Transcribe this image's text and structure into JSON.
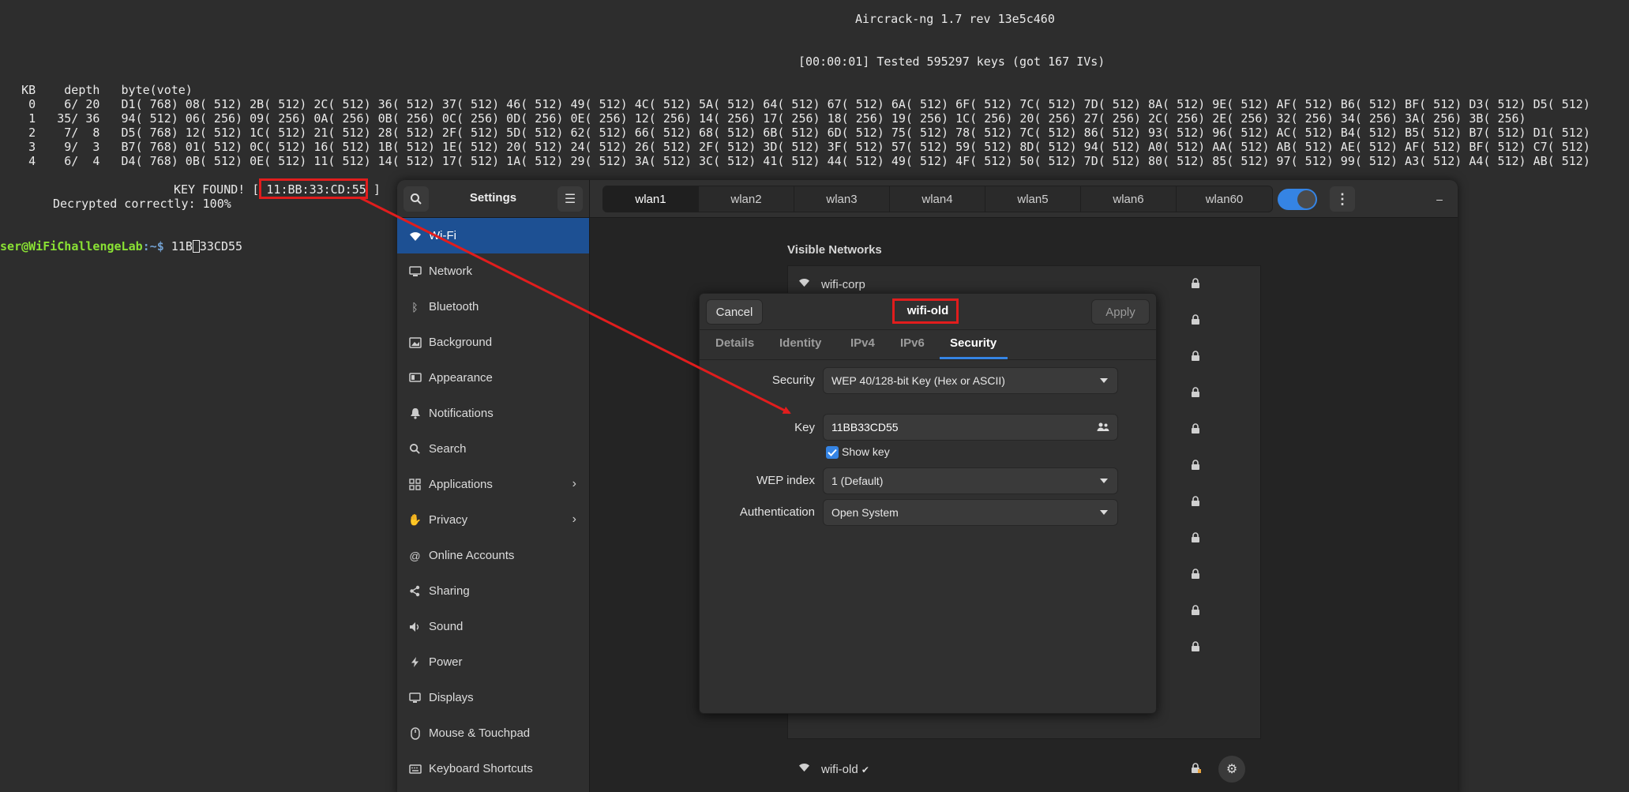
{
  "terminal": {
    "header": "Aircrack-ng 1.7 rev 13e5c460",
    "tested": "[00:00:01] Tested 595297 keys (got 167 IVs)",
    "table_header": "   KB    depth   byte(vote)",
    "rows": [
      "    0    6/ 20   D1( 768) 08( 512) 2B( 512) 2C( 512) 36( 512) 37( 512) 46( 512) 49( 512) 4C( 512) 5A( 512) 64( 512) 67( 512) 6A( 512) 6F( 512) 7C( 512) 7D( 512) 8A( 512) 9E( 512) AF( 512) B6( 512) BF( 512) D3( 512) D5( 512)",
      "    1   35/ 36   94( 512) 06( 256) 09( 256) 0A( 256) 0B( 256) 0C( 256) 0D( 256) 0E( 256) 12( 256) 14( 256) 17( 256) 18( 256) 19( 256) 1C( 256) 20( 256) 27( 256) 2C( 256) 2E( 256) 32( 256) 34( 256) 3A( 256) 3B( 256)",
      "    2    7/  8   D5( 768) 12( 512) 1C( 512) 21( 512) 28( 512) 2F( 512) 5D( 512) 62( 512) 66( 512) 68( 512) 6B( 512) 6D( 512) 75( 512) 78( 512) 7C( 512) 86( 512) 93( 512) 96( 512) AC( 512) B4( 512) B5( 512) B7( 512) D1( 512)",
      "    3    9/  3   B7( 768) 01( 512) 0C( 512) 16( 512) 1B( 512) 1E( 512) 20( 512) 24( 512) 26( 512) 2F( 512) 3D( 512) 3F( 512) 57( 512) 59( 512) 8D( 512) 94( 512) A0( 512) AA( 512) AB( 512) AE( 512) AF( 512) BF( 512) C7( 512)",
      "    4    6/  4   D4( 768) 0B( 512) 0E( 512) 11( 512) 14( 512) 17( 512) 1A( 512) 29( 512) 3A( 512) 3C( 512) 41( 512) 44( 512) 49( 512) 4F( 512) 50( 512) 7D( 512) 80( 512) 85( 512) 97( 512) 99( 512) A3( 512) A4( 512) AB( 512)"
    ],
    "key_found_prefix": "KEY FOUND! [",
    "key_found_value": "11:BB:33:CD:55",
    "key_found_suffix": "]",
    "decrypted": "Decrypted correctly: 100%",
    "prompt_user": "user@WiFiChallengeLab",
    "prompt_path": ":~$",
    "command_before_cursor": " 11B",
    "command_cursor_char": "B",
    "command_after_cursor": "33CD55"
  },
  "settings": {
    "title": "Settings",
    "sidebar": [
      {
        "label": "Wi-Fi",
        "icon": "wifi-icon",
        "active": true
      },
      {
        "label": "Network",
        "icon": "network-icon"
      },
      {
        "label": "Bluetooth",
        "icon": "bluetooth-icon"
      },
      {
        "label": "Background",
        "icon": "background-icon"
      },
      {
        "label": "Appearance",
        "icon": "appearance-icon"
      },
      {
        "label": "Notifications",
        "icon": "bell-icon"
      },
      {
        "label": "Search",
        "icon": "search-icon"
      },
      {
        "label": "Applications",
        "icon": "grid-icon",
        "chevron": true
      },
      {
        "label": "Privacy",
        "icon": "hand-icon",
        "chevron": true
      },
      {
        "label": "Online Accounts",
        "icon": "at-icon"
      },
      {
        "label": "Sharing",
        "icon": "share-icon"
      },
      {
        "label": "Sound",
        "icon": "speaker-icon"
      },
      {
        "label": "Power",
        "icon": "power-icon"
      },
      {
        "label": "Displays",
        "icon": "display-icon"
      },
      {
        "label": "Mouse & Touchpad",
        "icon": "mouse-icon"
      },
      {
        "label": "Keyboard Shortcuts",
        "icon": "keyboard-icon"
      }
    ],
    "tabs": [
      "wlan1",
      "wlan2",
      "wlan3",
      "wlan4",
      "wlan5",
      "wlan6",
      "wlan60"
    ],
    "active_tab": "wlan1",
    "wifi_enabled": true,
    "window_controls": {
      "minimize": "–",
      "maximize": "□",
      "close": "✕"
    },
    "visible_networks_title": "Visible Networks",
    "networks": [
      {
        "name": "wifi-corp",
        "locked": true
      },
      {
        "name": "",
        "locked": true
      },
      {
        "name": "",
        "locked": true
      },
      {
        "name": "",
        "locked": true
      },
      {
        "name": "",
        "locked": true
      },
      {
        "name": "",
        "locked": true
      },
      {
        "name": "",
        "locked": true
      },
      {
        "name": "",
        "locked": true
      },
      {
        "name": "",
        "locked": true
      },
      {
        "name": "",
        "locked": true
      },
      {
        "name": "",
        "locked": true
      }
    ],
    "connected_network": {
      "name": "wifi-old",
      "status": "✔"
    }
  },
  "dialog": {
    "title": "wifi-old",
    "cancel": "Cancel",
    "apply": "Apply",
    "tabs": [
      "Details",
      "Identity",
      "IPv4",
      "IPv6",
      "Security"
    ],
    "active_tab": "Security",
    "security_label": "Security",
    "security_value": "WEP 40/128-bit Key (Hex or ASCII)",
    "key_label": "Key",
    "key_value": "11BB33CD55",
    "show_key_label": "Show key",
    "show_key_checked": true,
    "wep_index_label": "WEP index",
    "wep_index_value": "1 (Default)",
    "auth_label": "Authentication",
    "auth_value": "Open System"
  },
  "colors": {
    "accent": "#3584e4",
    "sidebar_active": "#1d5093",
    "highlight_red": "#e11d1d",
    "prompt_green": "#8ae234"
  }
}
